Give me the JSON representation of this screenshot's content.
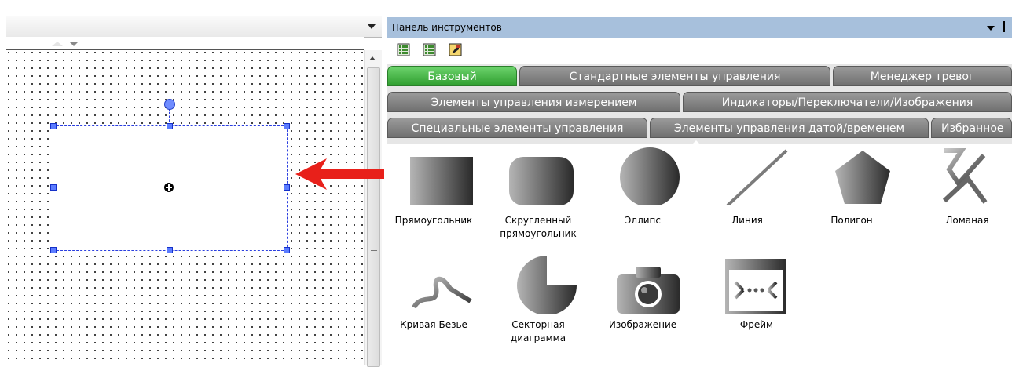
{
  "toolbox": {
    "title": "Панель инструментов",
    "tabs_row1": [
      {
        "label": "Базовый",
        "active": true
      },
      {
        "label": "Стандартные элементы управления",
        "active": false
      },
      {
        "label": "Менеджер тревог",
        "active": false
      }
    ],
    "tabs_row2": [
      {
        "label": "Элементы управления измерением"
      },
      {
        "label": "Индикаторы/Переключатели/Изображения"
      }
    ],
    "tabs_row3": [
      {
        "label": "Специальные элементы управления"
      },
      {
        "label": "Элементы управления датой/временем"
      },
      {
        "label": "Избранное"
      }
    ],
    "items": [
      {
        "label": "Прямоугольник",
        "icon": "rectangle-icon"
      },
      {
        "label": "Скругленный прямоугольник",
        "icon": "rounded-rectangle-icon"
      },
      {
        "label": "Эллипс",
        "icon": "ellipse-icon"
      },
      {
        "label": "Линия",
        "icon": "line-icon"
      },
      {
        "label": "Полигон",
        "icon": "polygon-icon"
      },
      {
        "label": "Ломаная",
        "icon": "polyline-icon"
      },
      {
        "label": "Кривая Безье",
        "icon": "bezier-curve-icon"
      },
      {
        "label": "Секторная диаграмма",
        "icon": "pie-chart-icon"
      },
      {
        "label": "Изображение",
        "icon": "camera-icon"
      },
      {
        "label": "Фрейм",
        "icon": "frame-icon"
      }
    ]
  },
  "colors": {
    "active_tab": "#3fae3f",
    "inactive_tab": "#7f7f7f",
    "title_bar": "#a7c0dc",
    "selection": "#2b3fe0",
    "arrow": "#e8201a"
  }
}
